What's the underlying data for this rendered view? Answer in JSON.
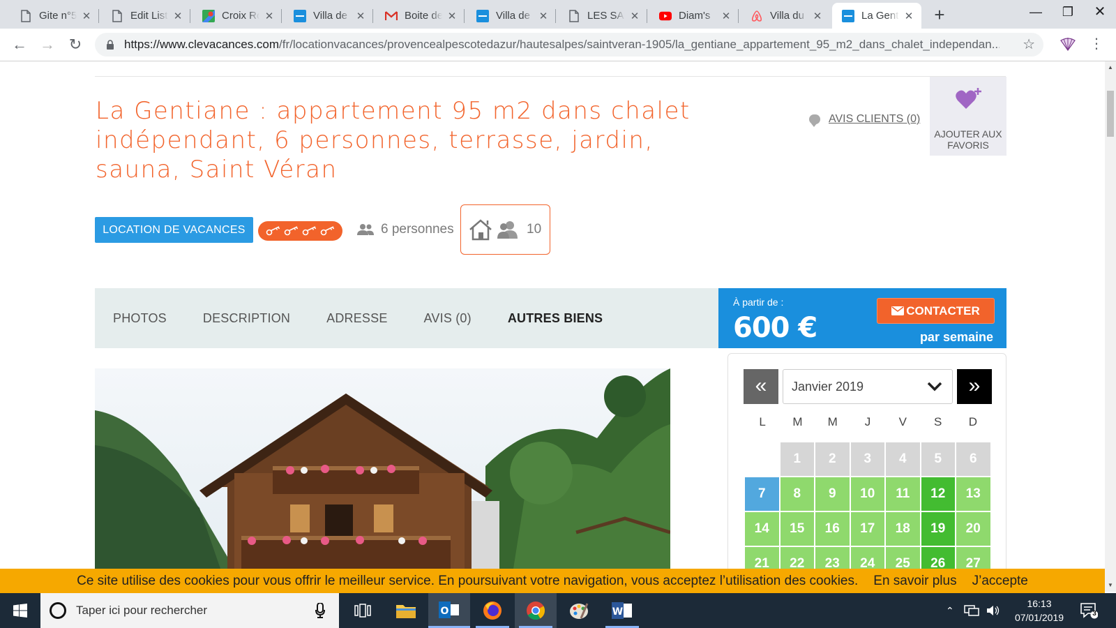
{
  "browser": {
    "tabs": [
      {
        "title": "Gite n°5",
        "icon": "doc-icon"
      },
      {
        "title": "Edit Listing",
        "icon": "doc-icon"
      },
      {
        "title": "Croix Rousse",
        "icon": "maps-icon"
      },
      {
        "title": "Villa de",
        "icon": "clevacances-icon"
      },
      {
        "title": "Boite de",
        "icon": "gmail-icon"
      },
      {
        "title": "Villa de",
        "icon": "clevacances-icon"
      },
      {
        "title": "LES SAL",
        "icon": "doc-icon"
      },
      {
        "title": "Diam's",
        "icon": "youtube-icon"
      },
      {
        "title": "Villa du",
        "icon": "airbnb-icon"
      },
      {
        "title": "La Gentiane",
        "icon": "clevacances-icon",
        "active": true
      }
    ],
    "url": "https://www.clevacances.com/fr/locationvacances/provencealpescotedazur/hautesalpes/saintveran-1905/la_gentiane_appartement_95_m2_dans_chalet_independan...",
    "url_host": "https://www.clevacances.com",
    "url_path": "/fr/locationvacances/provencealpescotedazur/hautesalpes/saintveran-1905/la_gentiane_appartement_95_m2_dans_chalet_independan..."
  },
  "listing": {
    "title": "La Gentiane : appartement 95 m2 dans chalet indépendant, 6 personnes, terrasse, jardin, sauna, Saint Véran",
    "reviews_link": "AVIS CLIENTS (0)",
    "favorite_label": "AJOUTER AUX FAVORIS",
    "type_badge": "LOCATION DE VACANCES",
    "keys_rating": 4,
    "persons": "6 personnes",
    "capacity": "10"
  },
  "nav": {
    "items": [
      "PHOTOS",
      "DESCRIPTION",
      "ADRESSE",
      "AVIS (0)",
      "AUTRES BIENS"
    ]
  },
  "pricing": {
    "from_label": "À partir de :",
    "price": "600 €",
    "period": "par semaine",
    "contact_label": "CONTACTER"
  },
  "calendar": {
    "month": "Janvier 2019",
    "prev": "«",
    "next": "»",
    "day_names": [
      "L",
      "M",
      "M",
      "J",
      "V",
      "S",
      "D"
    ],
    "days": [
      {
        "d": "",
        "s": "empty"
      },
      {
        "d": "1",
        "s": "past"
      },
      {
        "d": "2",
        "s": "past"
      },
      {
        "d": "3",
        "s": "past"
      },
      {
        "d": "4",
        "s": "past"
      },
      {
        "d": "5",
        "s": "past"
      },
      {
        "d": "6",
        "s": "past"
      },
      {
        "d": "7",
        "s": "today"
      },
      {
        "d": "8",
        "s": "free"
      },
      {
        "d": "9",
        "s": "free"
      },
      {
        "d": "10",
        "s": "free"
      },
      {
        "d": "11",
        "s": "free"
      },
      {
        "d": "12",
        "s": "sat"
      },
      {
        "d": "13",
        "s": "free"
      },
      {
        "d": "14",
        "s": "free"
      },
      {
        "d": "15",
        "s": "free"
      },
      {
        "d": "16",
        "s": "free"
      },
      {
        "d": "17",
        "s": "free"
      },
      {
        "d": "18",
        "s": "free"
      },
      {
        "d": "19",
        "s": "sat"
      },
      {
        "d": "20",
        "s": "free"
      },
      {
        "d": "21",
        "s": "free"
      },
      {
        "d": "22",
        "s": "free"
      },
      {
        "d": "23",
        "s": "free"
      },
      {
        "d": "24",
        "s": "free"
      },
      {
        "d": "25",
        "s": "free"
      },
      {
        "d": "26",
        "s": "sat"
      },
      {
        "d": "27",
        "s": "free"
      }
    ]
  },
  "cookie": {
    "text": "Ce site utilise des cookies pour vous offrir le meilleur service. En poursuivant votre navigation, vous acceptez l’utilisation des cookies.",
    "more": "En savoir plus",
    "accept": "J’accepte"
  },
  "taskbar": {
    "search_placeholder": "Taper ici pour rechercher",
    "time": "16:13",
    "date": "07/01/2019",
    "notifications": "3"
  },
  "colors": {
    "brand_orange": "#f2632b",
    "brand_blue": "#1a8fdd",
    "available": "#8fd96d",
    "saturday": "#43bc31",
    "cookie_bar": "#f6a800"
  }
}
